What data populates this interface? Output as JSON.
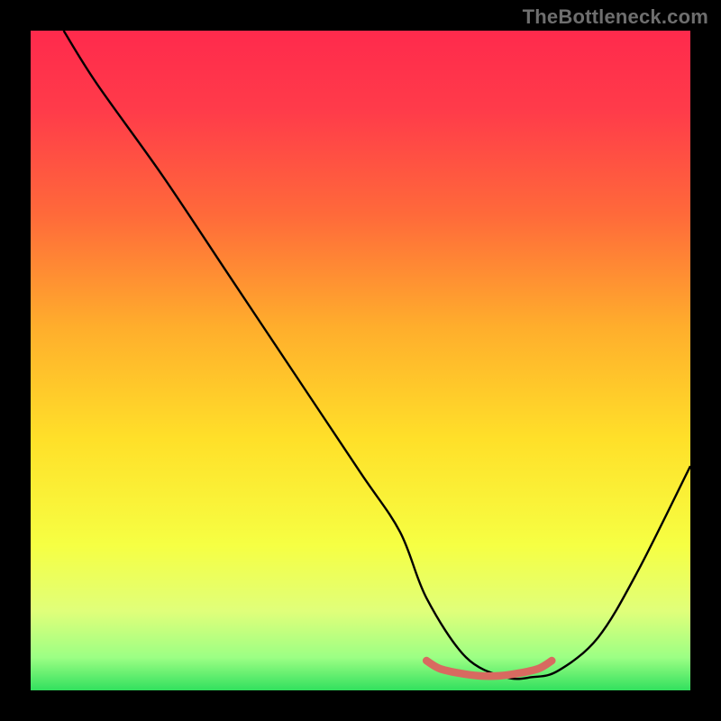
{
  "watermark": "TheBottleneck.com",
  "gradient": {
    "stops": [
      {
        "offset": 0.0,
        "color": "#ff2a4c"
      },
      {
        "offset": 0.12,
        "color": "#ff3b4a"
      },
      {
        "offset": 0.28,
        "color": "#ff6a3a"
      },
      {
        "offset": 0.45,
        "color": "#ffae2c"
      },
      {
        "offset": 0.62,
        "color": "#ffe029"
      },
      {
        "offset": 0.78,
        "color": "#f6ff43"
      },
      {
        "offset": 0.88,
        "color": "#e0ff7a"
      },
      {
        "offset": 0.95,
        "color": "#9cff84"
      },
      {
        "offset": 1.0,
        "color": "#32e05e"
      }
    ]
  },
  "chart_data": {
    "type": "line",
    "title": "",
    "xlabel": "",
    "ylabel": "",
    "xlim": [
      0,
      100
    ],
    "ylim": [
      0,
      100
    ],
    "series": [
      {
        "name": "bottleneck-curve",
        "x": [
          5,
          10,
          20,
          30,
          40,
          50,
          56,
          60,
          66,
          72,
          76,
          80,
          86,
          92,
          100
        ],
        "y": [
          100,
          92,
          78,
          63,
          48,
          33,
          24,
          14,
          5,
          2,
          2,
          3,
          8,
          18,
          34
        ]
      },
      {
        "name": "optimal-band",
        "x": [
          60,
          62,
          65,
          68,
          71,
          74,
          77,
          79
        ],
        "y": [
          4.5,
          3.3,
          2.6,
          2.2,
          2.2,
          2.6,
          3.3,
          4.5
        ]
      }
    ],
    "styles": {
      "bottleneck-curve": {
        "stroke": "#000000",
        "width": 2.4,
        "fill": "none"
      },
      "optimal-band": {
        "stroke": "#d86a60",
        "width": 8.5,
        "fill": "none",
        "linecap": "round"
      }
    }
  }
}
